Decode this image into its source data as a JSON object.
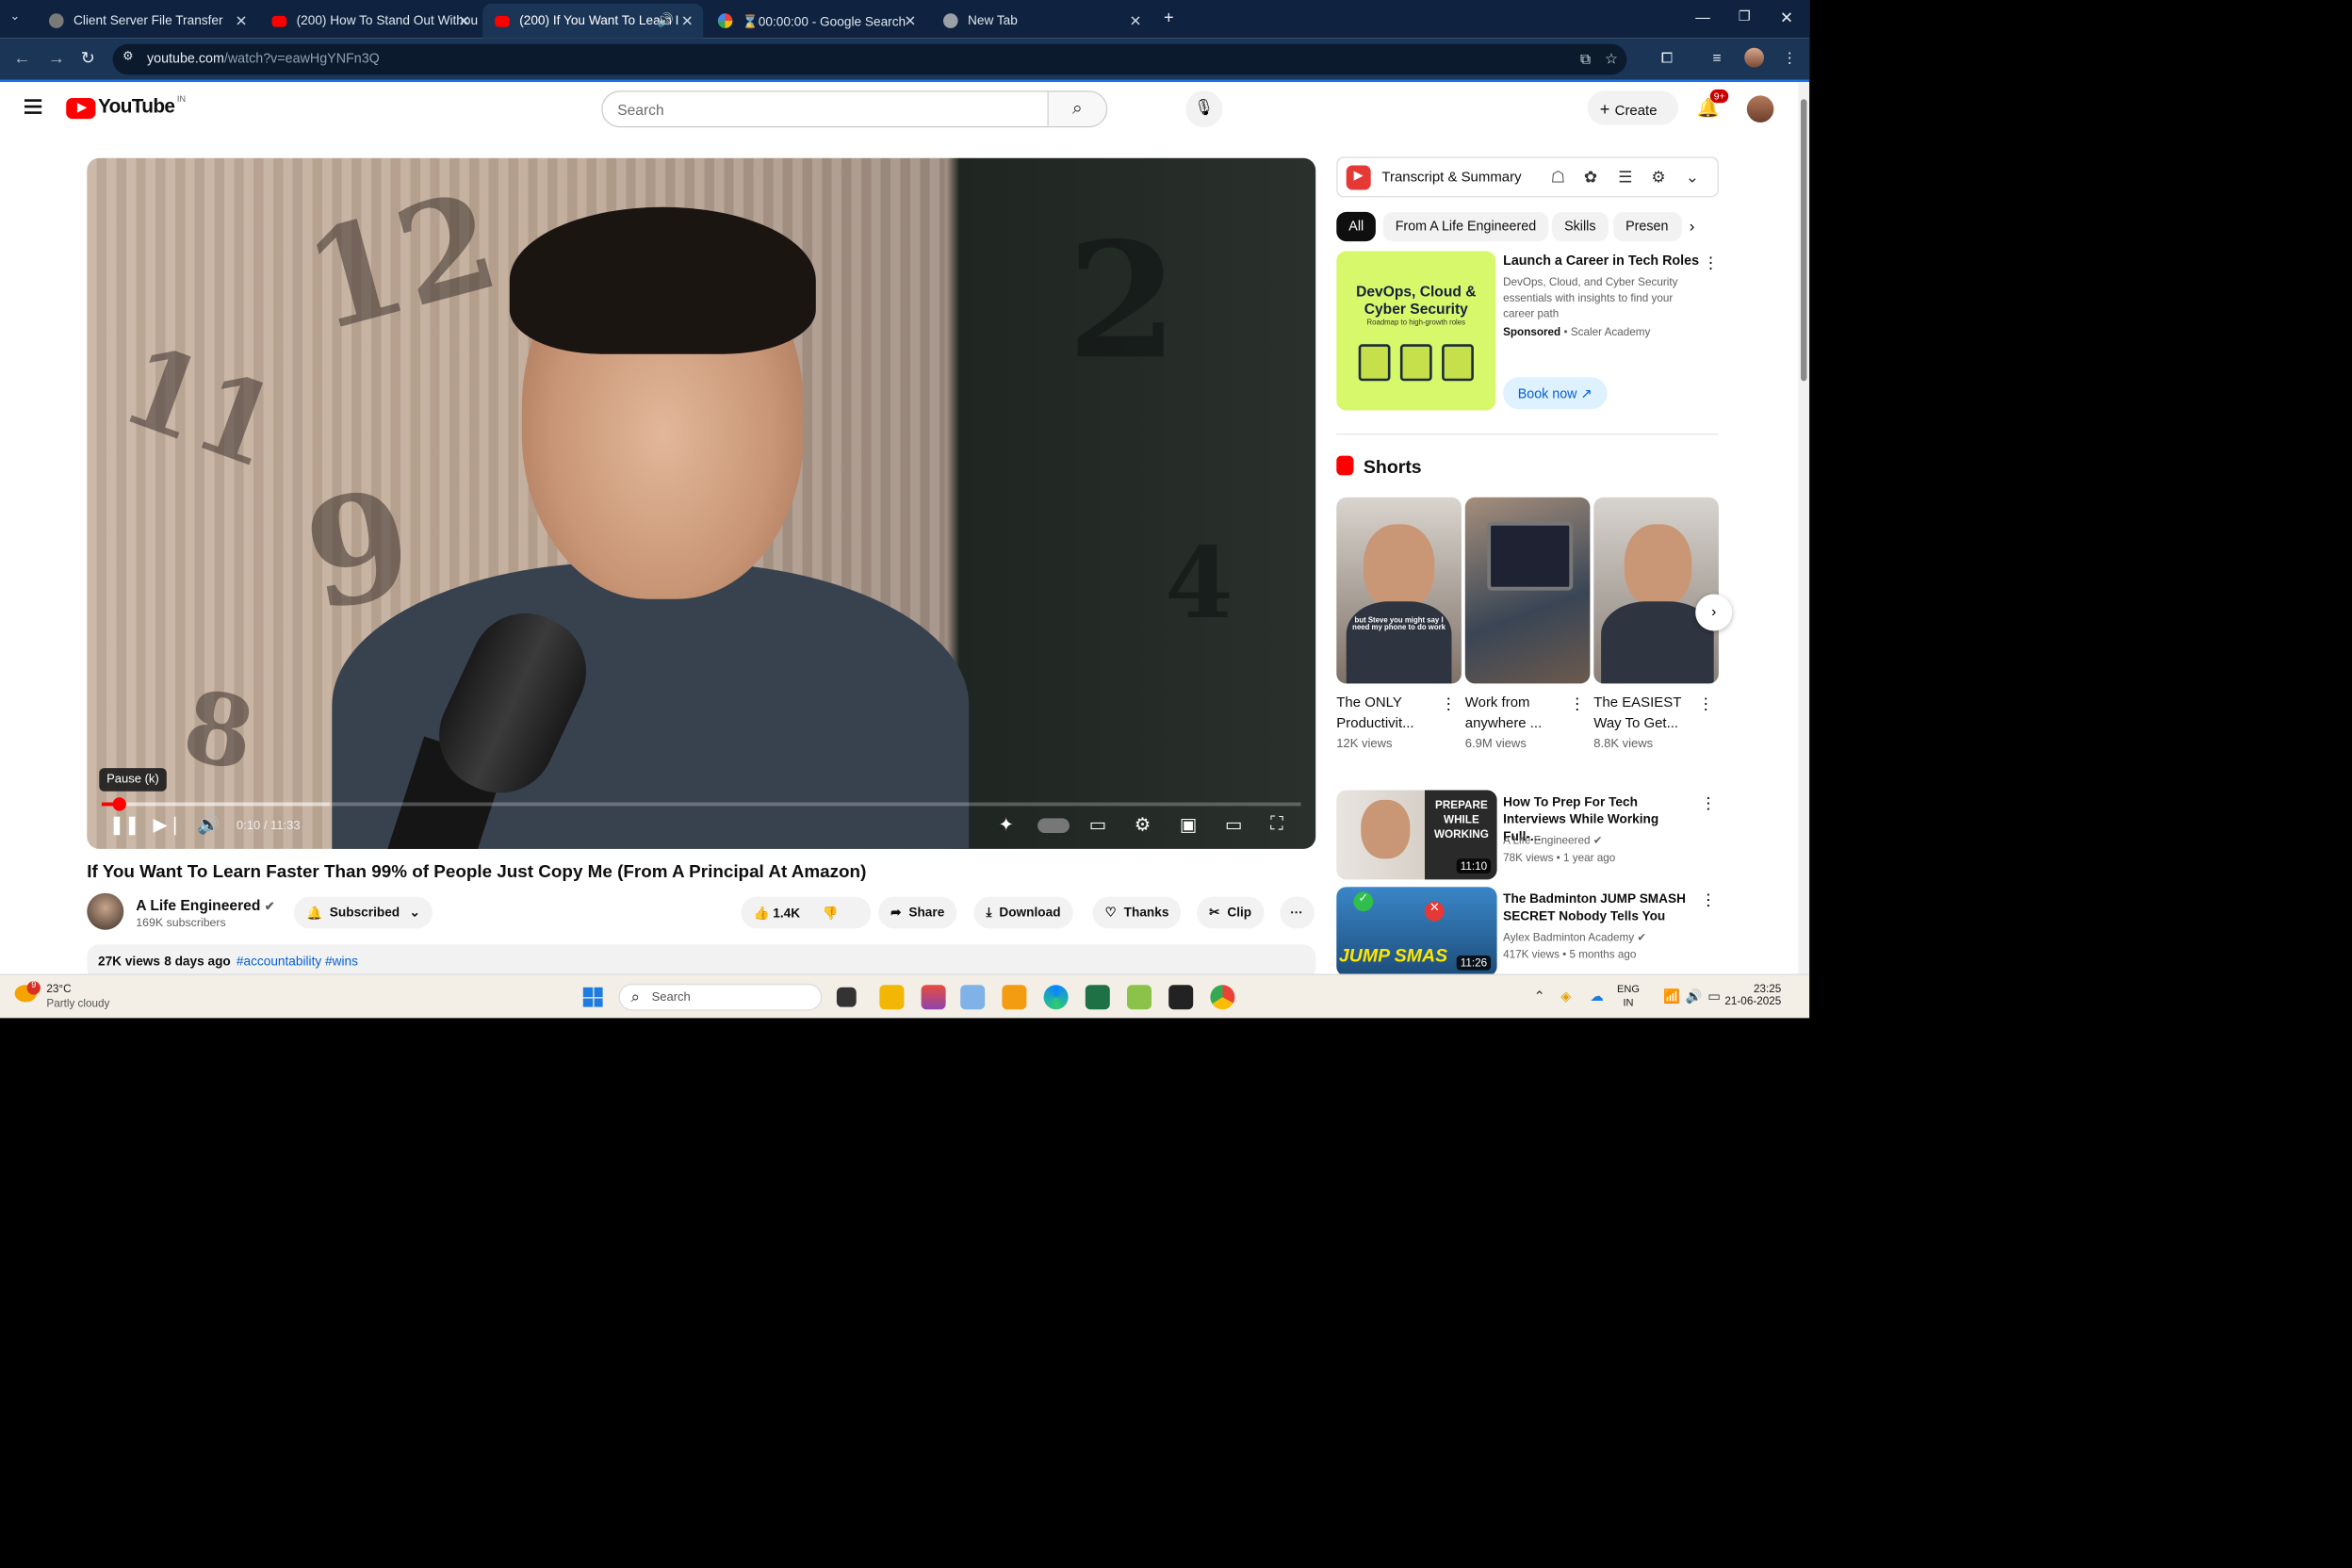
{
  "browser": {
    "tabs": [
      {
        "title": "Client Server File Transfer",
        "fav_color": "#7a7a7a"
      },
      {
        "title": "(200) How To Stand Out Withou",
        "fav_color": "#ff0000"
      },
      {
        "title": "(200) If You Want To Learn I",
        "fav_color": "#ff0000"
      },
      {
        "title": "⌛00:00:00 - Google Search",
        "fav_color": "#4285f4"
      },
      {
        "title": "New Tab",
        "fav_color": "#9aa0a6"
      }
    ],
    "url_host": "youtube.com",
    "url_path": "/watch?v=eawHgYNFn3Q",
    "new_tab_icon": "+",
    "accent": "#1a73e8"
  },
  "youtube": {
    "logo_text": "YouTube",
    "country_code": "IN",
    "search_placeholder": "Search",
    "create_label": "Create",
    "notifications_badge": "9+"
  },
  "player": {
    "tooltip": "Pause (k)",
    "time_current": "0:10",
    "time_total": "11:33",
    "time_display": "0:10 / 11:33",
    "progress_fraction": 0.014,
    "buffered_fraction": 0.19
  },
  "video": {
    "title": "If You Want To Learn Faster Than 99% of People Just Copy Me (From A Principal At Amazon)",
    "channel": "A Life Engineered",
    "subscribers": "169K subscribers",
    "subscribed_label": "Subscribed",
    "likes": "1.4K",
    "share_label": "Share",
    "download_label": "Download",
    "thanks_label": "Thanks",
    "clip_label": "Clip",
    "views": "27K views",
    "age": "8 days ago",
    "tags": "#accountability #wins"
  },
  "sidebar": {
    "extension_title": "Transcript & Summary",
    "chips": [
      "All",
      "From A Life Engineered",
      "Skills",
      "Presen"
    ],
    "ad": {
      "image_headline": "DevOps, Cloud & Cyber Security",
      "image_sub": "Roadmap to high-growth roles",
      "title": "Launch a Career in Tech Roles",
      "desc": "DevOps, Cloud, and Cyber Security essentials with insights to find your career path",
      "sponsored": "Sponsored",
      "advertiser": "Scaler Academy",
      "cta": "Book now"
    },
    "shorts_heading": "Shorts",
    "shorts": [
      {
        "title": "The ONLY Productivit...",
        "views": "12K views"
      },
      {
        "title": "Work from anywhere ...",
        "views": "6.9M views"
      },
      {
        "title": "The EASIEST Way To Get...",
        "views": "8.8K views"
      }
    ],
    "short1_caption": "but Steve you might say I need my phone to do work",
    "videos": [
      {
        "title": "How To Prep For Tech Interviews While Working Full-...",
        "channel": "A Life Engineered",
        "meta": "78K views • 1 year ago",
        "duration": "11:10",
        "thumb_text": "PREPARE WHILE WORKING"
      },
      {
        "title": "The Badminton JUMP SMASH SECRET Nobody Tells You",
        "channel": "Aylex Badminton Academy",
        "meta": "417K views • 5 months ago",
        "duration": "11:26",
        "thumb_text": "JUMP SMAS"
      }
    ]
  },
  "taskbar": {
    "weather_temp": "23°C",
    "weather_desc": "Partly cloudy",
    "weather_badge": "9",
    "search_placeholder": "Search",
    "lang_1": "ENG",
    "lang_2": "IN",
    "time": "23:25",
    "date": "21-06-2025"
  }
}
